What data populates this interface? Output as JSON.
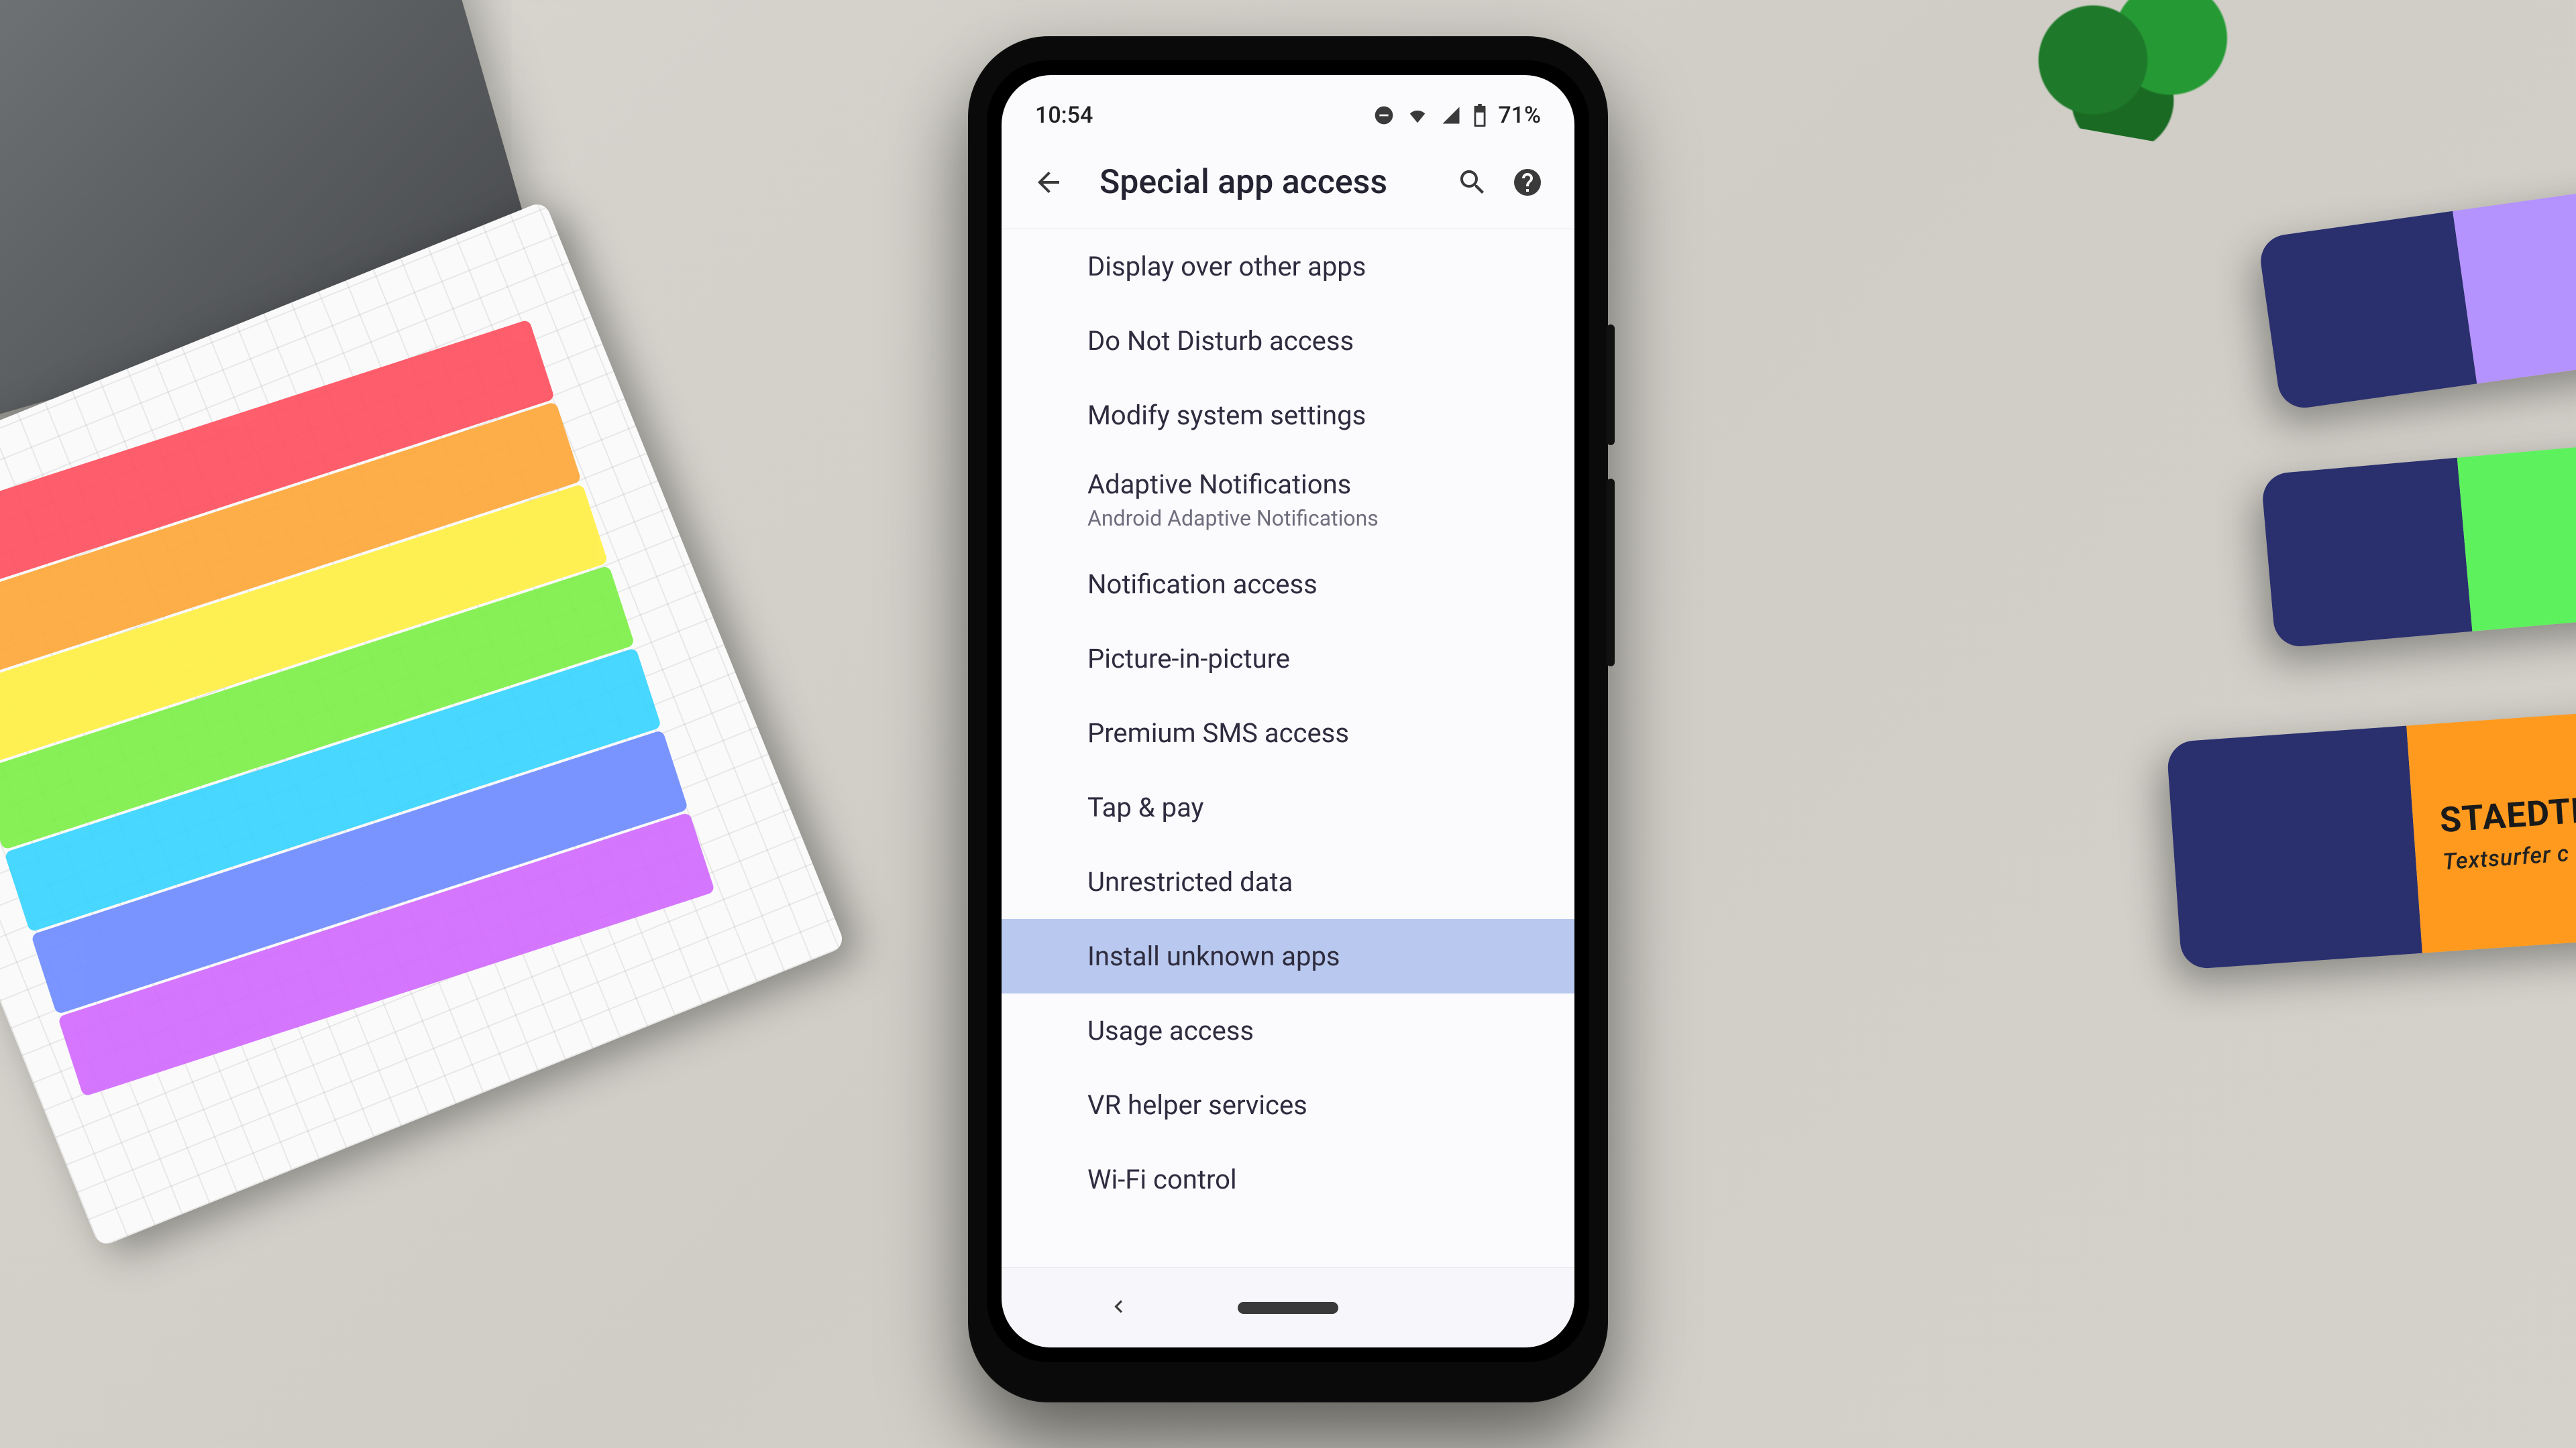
{
  "status": {
    "time": "10:54",
    "battery": "71%"
  },
  "appbar": {
    "title": "Special app access"
  },
  "items": [
    {
      "label": "Display over other apps"
    },
    {
      "label": "Do Not Disturb access"
    },
    {
      "label": "Modify system settings"
    },
    {
      "label": "Adaptive Notifications",
      "sub": "Android Adaptive Notifications"
    },
    {
      "label": "Notification access"
    },
    {
      "label": "Picture-in-picture"
    },
    {
      "label": "Premium SMS access"
    },
    {
      "label": "Tap & pay"
    },
    {
      "label": "Unrestricted data"
    },
    {
      "label": "Install unknown apps",
      "highlight": true
    },
    {
      "label": "Usage access"
    },
    {
      "label": "VR helper services"
    },
    {
      "label": "Wi-Fi control"
    }
  ],
  "highlighter": {
    "brand": "STAEDTL",
    "sub": "Textsurfer c"
  }
}
